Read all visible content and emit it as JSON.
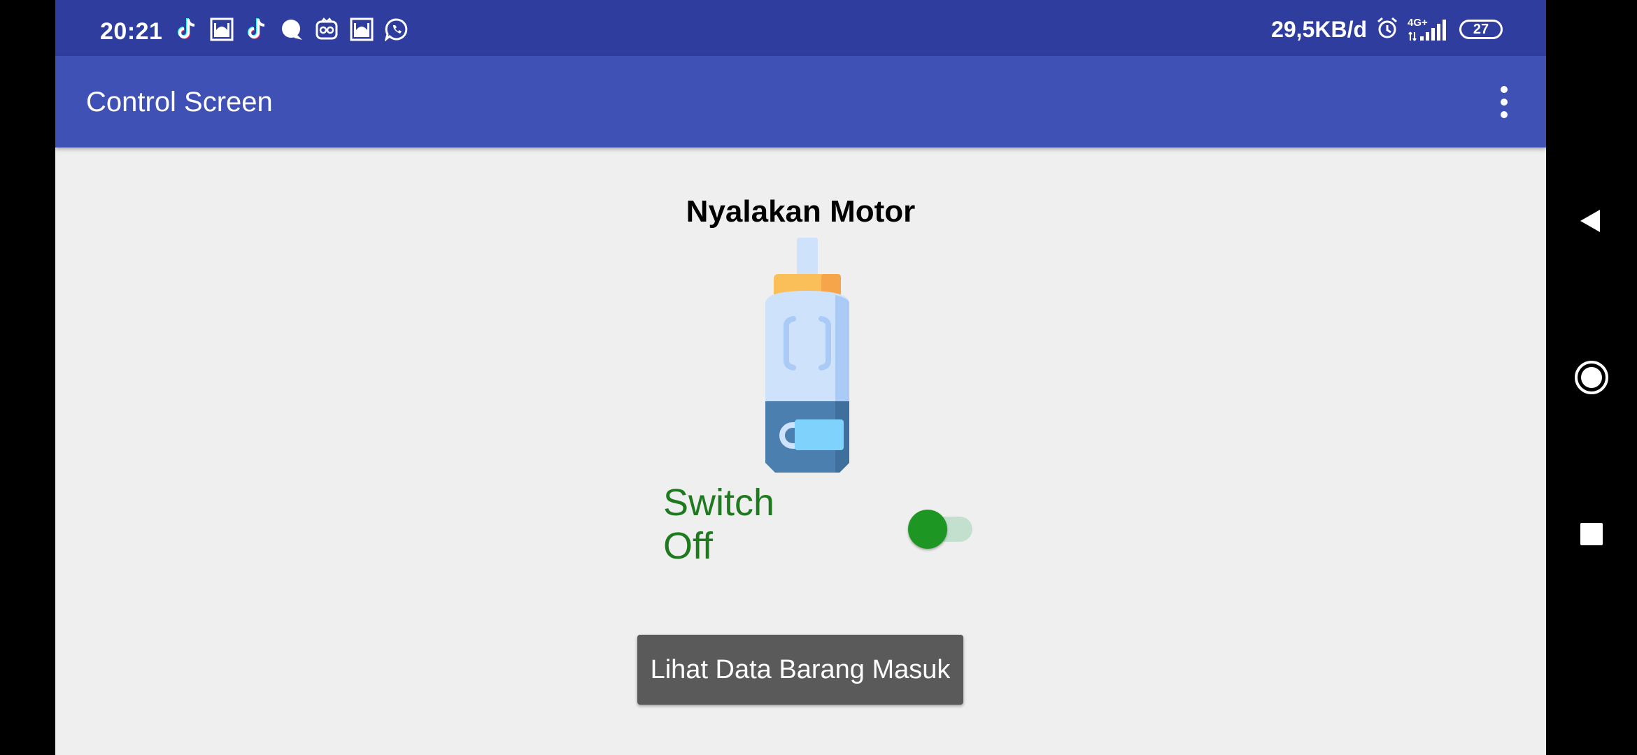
{
  "status_bar": {
    "time": "20:21",
    "network_speed": "29,5KB/d",
    "network_type": "4G+",
    "battery_level": "27",
    "notification_icons": [
      "tiktok-icon",
      "mosque-app-icon",
      "tiktok-icon",
      "message-bubble-icon",
      "owl-app-icon",
      "mosque-app-icon",
      "whatsapp-icon"
    ],
    "status_icons": [
      "alarm-icon",
      "signal-icon",
      "battery-icon"
    ]
  },
  "app_bar": {
    "title": "Control Screen",
    "menu_icon": "more-vert-icon"
  },
  "main": {
    "heading": "Nyalakan Motor",
    "motor_image": "dc-motor-icon",
    "switch_label": "Switch Off",
    "switch_state": "off",
    "button_label": "Lihat Data Barang Masuk"
  },
  "colors": {
    "status_bar": "#2f3e9e",
    "app_bar": "#3f51b5",
    "switch_text": "#1f7a1f",
    "switch_thumb": "#1e9624",
    "button_bg": "#5a5a5a"
  },
  "nav_bar": {
    "buttons": [
      "back-icon",
      "home-icon",
      "recents-icon"
    ]
  }
}
